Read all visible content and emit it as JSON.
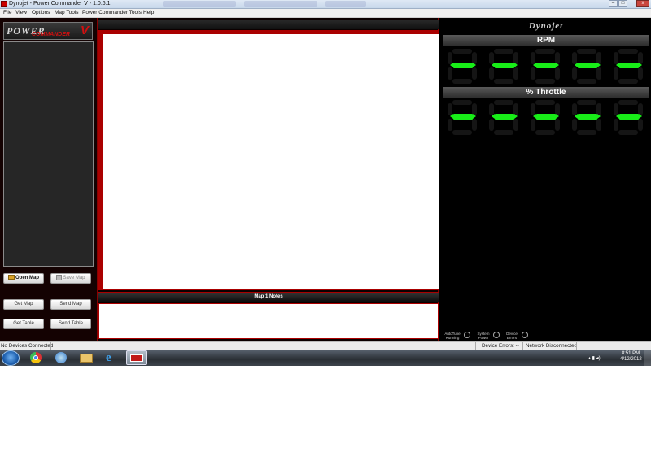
{
  "window": {
    "title": "Dynojet - Power Commander V - 1.0.6.1",
    "controls": {
      "minimize": "–",
      "maximize": "□",
      "close": "x"
    }
  },
  "menu": [
    "File",
    "View",
    "Options",
    "Map Tools",
    "Power Commander Tools",
    "Help"
  ],
  "logo": {
    "main": "POWER",
    "sub": "COMMANDER",
    "version": "V"
  },
  "left_buttons": {
    "open_map": "Open Map",
    "save_map": "Save Map",
    "get_map": "Get Map",
    "send_map": "Send Map",
    "get_table": "Get Table",
    "send_table": "Send Table"
  },
  "center": {
    "notes_title": "Map 1 Notes"
  },
  "right": {
    "brand": "Dynojet",
    "rpm_title": "RPM",
    "throttle_title": "% Throttle",
    "rpm_digits": [
      "-",
      "-",
      "-",
      "-",
      "-"
    ],
    "throttle_digits": [
      "-",
      "-",
      "-",
      "-",
      "-"
    ],
    "indicators": [
      {
        "line1": "AutoTune",
        "line2": "Running"
      },
      {
        "line1": "System",
        "line2": "Power"
      },
      {
        "line1": "Device",
        "line2": "Errors"
      }
    ]
  },
  "statusbar": {
    "connection": "No Devices Connected",
    "device_errors": "Device Errors: --",
    "network": "Network Disconnected"
  },
  "taskbar": {
    "time": "8:51 PM",
    "date": "4/12/2012",
    "apps": [
      "chrome-icon",
      "itunes-icon",
      "explorer-icon",
      "ie-icon",
      "power-commander-icon"
    ]
  },
  "colors": {
    "accent_red": "#aa0000",
    "digit_green": "#18ee18"
  }
}
